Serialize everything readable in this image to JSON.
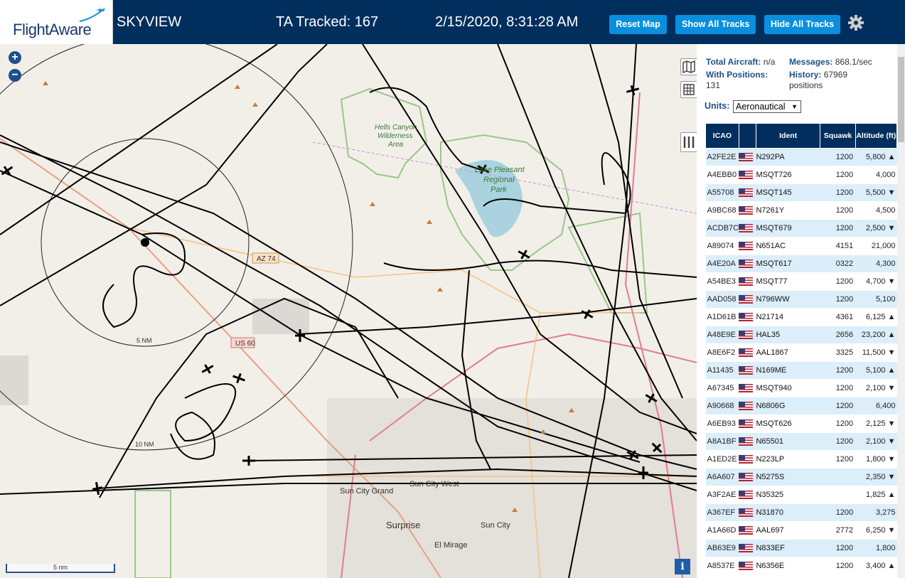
{
  "header": {
    "logo_text": "FlightAware",
    "app_title": "SKYVIEW",
    "tracked": "TA Tracked: 167",
    "clock": "2/15/2020, 8:31:28 AM",
    "buttons": {
      "reset": "Reset Map",
      "show": "Show All Tracks",
      "hide": "Hide All Tracks"
    }
  },
  "map": {
    "labels": {
      "hells": "Hells Canyon",
      "wilderness": "Wilderness",
      "area": "Area",
      "lake": "Lake Pleasant",
      "regional": "Regional",
      "park": "Park",
      "az74": "AZ 74",
      "us60": "US 60",
      "sun_city_grand": "Sun City Grand",
      "sun_city_west": "Sun City West",
      "surprise": "Surprise",
      "sun_city": "Sun City",
      "el_mirage": "El Mirage",
      "ring5": "5 NM",
      "ring10": "10 NM"
    },
    "scale_label": "5 nm",
    "info": "i"
  },
  "sidebar": {
    "total_label": "Total Aircraft:",
    "total_value": "n/a",
    "messages_label": "Messages:",
    "messages_value": "868.1/sec",
    "positions_label": "With Positions:",
    "positions_value": "131",
    "history_label": "History:",
    "history_value": "67969",
    "history_unit": "positions",
    "units_label": "Units:",
    "units_value": "Aeronautical",
    "columns": [
      "ICAO",
      "",
      "Ident",
      "Squawk",
      "Altitude (ft)"
    ],
    "rows": [
      {
        "icao": "A2FE2E",
        "ident": "N292PA",
        "squawk": "1200",
        "alt": "5,800 ▲"
      },
      {
        "icao": "A4EBB0",
        "ident": "MSQT726",
        "squawk": "1200",
        "alt": "4,000"
      },
      {
        "icao": "A55708",
        "ident": "MSQT145",
        "squawk": "1200",
        "alt": "5,500 ▼"
      },
      {
        "icao": "A9BC68",
        "ident": "N7261Y",
        "squawk": "1200",
        "alt": "4,500"
      },
      {
        "icao": "ACDB7C",
        "ident": "MSQT679",
        "squawk": "1200",
        "alt": "2,500 ▼"
      },
      {
        "icao": "A89074",
        "ident": "N651AC",
        "squawk": "4151",
        "alt": "21,000"
      },
      {
        "icao": "A4E20A",
        "ident": "MSQT617",
        "squawk": "0322",
        "alt": "4,300"
      },
      {
        "icao": "A54BE3",
        "ident": "MSQT77",
        "squawk": "1200",
        "alt": "4,700 ▼"
      },
      {
        "icao": "AAD058",
        "ident": "N796WW",
        "squawk": "1200",
        "alt": "5,100"
      },
      {
        "icao": "A1D61B",
        "ident": "N21714",
        "squawk": "4361",
        "alt": "6,125 ▲"
      },
      {
        "icao": "A48E9E",
        "ident": "HAL35",
        "squawk": "2656",
        "alt": "23,200 ▲"
      },
      {
        "icao": "A8E6F2",
        "ident": "AAL1867",
        "squawk": "3325",
        "alt": "11,500 ▼"
      },
      {
        "icao": "A11435",
        "ident": "N169ME",
        "squawk": "1200",
        "alt": "5,100 ▲"
      },
      {
        "icao": "A67345",
        "ident": "MSQT940",
        "squawk": "1200",
        "alt": "2,100 ▼"
      },
      {
        "icao": "A90668",
        "ident": "N6806G",
        "squawk": "1200",
        "alt": "6,400"
      },
      {
        "icao": "A6EB93",
        "ident": "MSQT626",
        "squawk": "1200",
        "alt": "2,125 ▼"
      },
      {
        "icao": "A8A1BF",
        "ident": "N65501",
        "squawk": "1200",
        "alt": "2,100 ▼"
      },
      {
        "icao": "A1ED2E",
        "ident": "N223LP",
        "squawk": "1200",
        "alt": "1,800 ▼"
      },
      {
        "icao": "A6A607",
        "ident": "N5275S",
        "squawk": "",
        "alt": "2,350 ▼"
      },
      {
        "icao": "A3F2AE",
        "ident": "N35325",
        "squawk": "",
        "alt": "1,825 ▲"
      },
      {
        "icao": "A367EF",
        "ident": "N31870",
        "squawk": "1200",
        "alt": "3,275"
      },
      {
        "icao": "A1A66D",
        "ident": "AAL697",
        "squawk": "2772",
        "alt": "6,250 ▼"
      },
      {
        "icao": "AB63E9",
        "ident": "N833EF",
        "squawk": "1200",
        "alt": "1,800"
      },
      {
        "icao": "A8537E",
        "ident": "N6356E",
        "squawk": "1200",
        "alt": "3,400 ▲"
      }
    ]
  }
}
